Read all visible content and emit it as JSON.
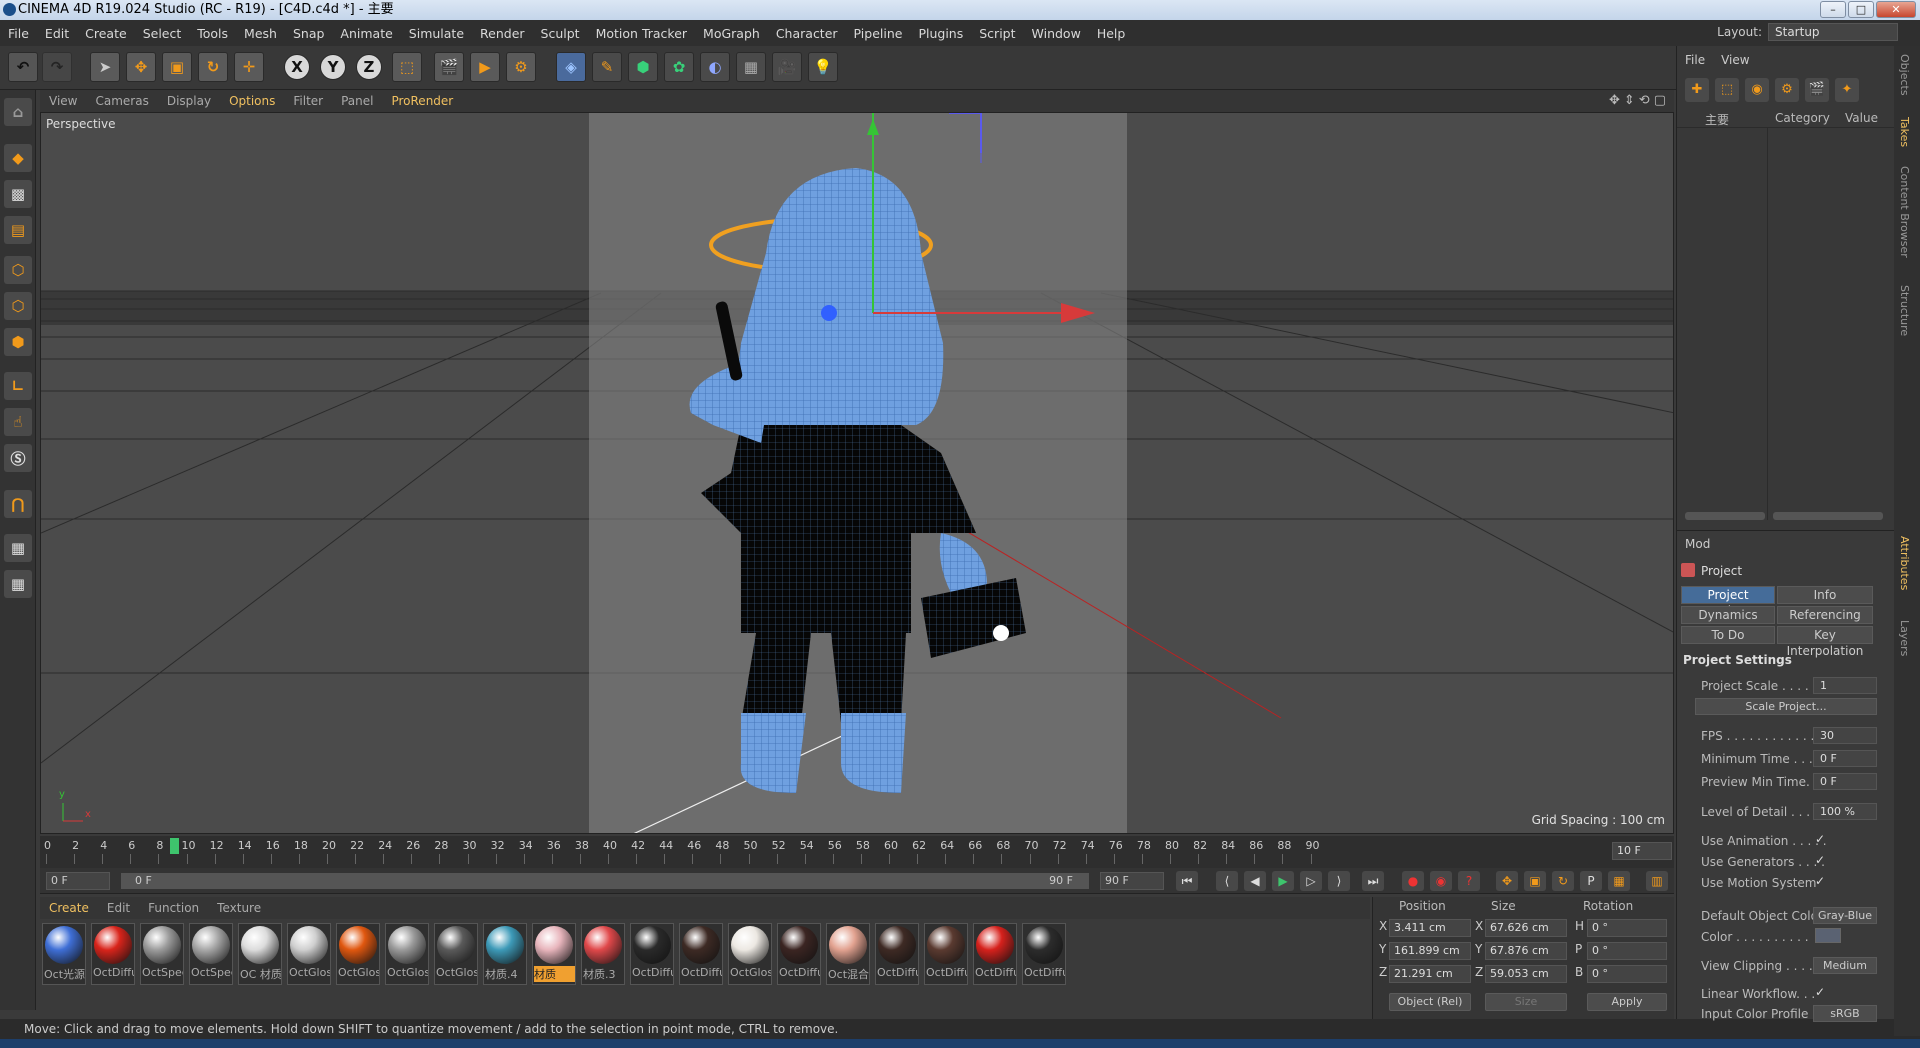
{
  "title": "CINEMA 4D R19.024 Studio (RC - R19) - [C4D.c4d *] - 主要",
  "menu": [
    "File",
    "Edit",
    "Create",
    "Select",
    "Tools",
    "Mesh",
    "Snap",
    "Animate",
    "Simulate",
    "Render",
    "Sculpt",
    "Motion Tracker",
    "MoGraph",
    "Character",
    "Pipeline",
    "Plugins",
    "Script",
    "Window",
    "Help"
  ],
  "layout": {
    "label": "Layout:",
    "value": "Startup"
  },
  "viewport": {
    "menu": [
      "View",
      "Cameras",
      "Display",
      "Options",
      "Filter",
      "Panel",
      "ProRender"
    ],
    "name": "Perspective",
    "grid_spacing": "Grid Spacing : 100 cm",
    "axis_x": "x",
    "axis_y": "y"
  },
  "timeline": {
    "ticks": [
      "0",
      "2",
      "4",
      "6",
      "8",
      "10",
      "12",
      "14",
      "16",
      "18",
      "20",
      "22",
      "24",
      "26",
      "28",
      "30",
      "32",
      "34",
      "36",
      "38",
      "40",
      "42",
      "44",
      "46",
      "48",
      "50",
      "52",
      "54",
      "56",
      "58",
      "60",
      "62",
      "64",
      "66",
      "68",
      "70",
      "72",
      "74",
      "76",
      "78",
      "80",
      "82",
      "84",
      "86",
      "88",
      "90"
    ],
    "current_frame": "10 F",
    "playhead_frame": 9
  },
  "transport": {
    "start": "0 F",
    "range_start": "0 F",
    "range_end": "90 F",
    "end": "90 F"
  },
  "materials": {
    "menu": [
      "Create",
      "Edit",
      "Function",
      "Texture"
    ],
    "items": [
      {
        "label": "Oct光源",
        "color": "#3f6fd6"
      },
      {
        "label": "OctDiffu",
        "color": "#d9241b"
      },
      {
        "label": "OctSpec",
        "color": "#9c9c9c"
      },
      {
        "label": "OctSpec",
        "color": "#a8a8a8"
      },
      {
        "label": "OC 材质",
        "color": "#dcdcdc"
      },
      {
        "label": "OctGlos",
        "color": "#cfcfcf"
      },
      {
        "label": "OctGlos",
        "color": "#e0570f"
      },
      {
        "label": "OctGlos",
        "color": "#9a9a9a"
      },
      {
        "label": "OctGlos",
        "color": "#5a5a5a"
      },
      {
        "label": "材质.4",
        "color": "#3d9ab8"
      },
      {
        "label": "材质",
        "color": "#e8b5bc"
      },
      {
        "label": "材质.3",
        "color": "#e0484a"
      },
      {
        "label": "OctDiffu",
        "color": "#2a2a2a"
      },
      {
        "label": "OctDiffu",
        "color": "#3d2a24"
      },
      {
        "label": "OctGlos",
        "color": "#ece8e2"
      },
      {
        "label": "OctDiffu",
        "color": "#3b2522"
      },
      {
        "label": "Oct混合",
        "color": "#e2a290"
      },
      {
        "label": "OctDiffu",
        "color": "#3e2a24"
      },
      {
        "label": "OctDiffu",
        "color": "#5a3a30"
      },
      {
        "label": "OctDiffu",
        "color": "#d6211c"
      },
      {
        "label": "OctDiffu",
        "color": "#2c2c2c"
      }
    ],
    "selected_index": 10
  },
  "coordinates": {
    "headers": [
      "Position",
      "Size",
      "Rotation"
    ],
    "rows": [
      {
        "axis": "X",
        "pos": "3.411 cm",
        "size_axis": "X",
        "size": "67.626 cm",
        "rot_axis": "H",
        "rot": "0 °"
      },
      {
        "axis": "Y",
        "pos": "161.899 cm",
        "size_axis": "Y",
        "size": "67.876 cm",
        "rot_axis": "P",
        "rot": "0 °"
      },
      {
        "axis": "Z",
        "pos": "21.291 cm",
        "size_axis": "Z",
        "size": "59.053 cm",
        "rot_axis": "B",
        "rot": "0 °"
      }
    ],
    "mode": "Object (Rel)",
    "size_mode": "Size",
    "apply": "Apply"
  },
  "status": "Move: Click and drag to move elements. Hold down SHIFT to quantize movement / add to the selection in point mode, CTRL to remove.",
  "object_panel": {
    "menu": [
      "File",
      "View"
    ],
    "columns": [
      "主要",
      "Category",
      "Value"
    ]
  },
  "side_tabs": [
    "Objects",
    "Takes",
    "Content Browser",
    "Structure"
  ],
  "side_tabs_bottom": [
    "Attributes",
    "Layers"
  ],
  "attributes": {
    "menu": [
      "Mod"
    ],
    "header": "Project",
    "tabs": [
      "Project Settings",
      "Info",
      "Dynamics",
      "Referencing",
      "To Do",
      "Key Interpolation"
    ],
    "section": "Project Settings",
    "project_scale": {
      "label": "Project Scale . . . . . .",
      "value": "1"
    },
    "scale_btn": "Scale Project...",
    "fps": {
      "label": "FPS . . . . . . . . . . . . . .",
      "value": "30"
    },
    "min_time": {
      "label": "Minimum Time . . . .",
      "value": "0 F"
    },
    "preview_min": {
      "label": "Preview Min Time. . .",
      "value": "0 F"
    },
    "lod": {
      "label": "Level of Detail . . . . .",
      "value": "100 %"
    },
    "use_animation": "Use Animation . . . . .",
    "use_generators": "Use Generators . . . .",
    "use_motion": "Use Motion System",
    "check": "✓",
    "default_color": {
      "label": "Default Object Color",
      "value": "Gray-Blue"
    },
    "color": "Color . . . . . . . . . .",
    "view_clipping": {
      "label": "View Clipping . . . . .",
      "value": "Medium"
    },
    "linear_workflow": "Linear Workflow. . .",
    "input_profile": {
      "label": "Input Color Profile . .",
      "value": "sRGB"
    }
  },
  "colors": {
    "accent": "#f19a1b",
    "highlight": "#f0c060",
    "tab_active": "#456c99",
    "playhead": "#3ec46d"
  }
}
